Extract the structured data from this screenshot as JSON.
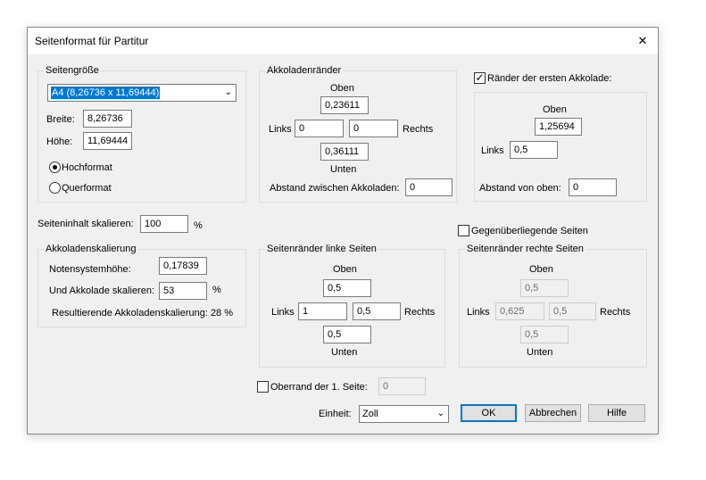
{
  "dialog": {
    "title": "Seitenformat für Partitur",
    "close_glyph": "✕"
  },
  "page_size": {
    "group_label": "Seitengröße",
    "selected": "A4 (8,26736 x 11,69444)",
    "width_label": "Breite:",
    "width_value": "8,26736",
    "height_label": "Höhe:",
    "height_value": "11,69444",
    "portrait_label": "Hochformat",
    "landscape_label": "Querformat"
  },
  "system_margins": {
    "group_label": "Akkoladenränder",
    "top_label": "Oben",
    "top_value": "0,23611",
    "left_label": "Links",
    "left_value": "0",
    "right_value": "0",
    "right_label": "Rechts",
    "bottom_value": "0,36111",
    "bottom_label": "Unten",
    "spacing_label": "Abstand zwischen Akkoladen:",
    "spacing_value": "0"
  },
  "first_system": {
    "checkbox_label": "Ränder der ersten Akkolade:",
    "checked": true,
    "top_label": "Oben",
    "top_value": "1,25694",
    "left_label": "Links",
    "left_value": "0,5",
    "distance_label": "Abstand von oben:",
    "distance_value": "0"
  },
  "scale": {
    "label": "Seiteninhalt skalieren:",
    "value": "100",
    "unit": "%"
  },
  "facing_pages": {
    "label": "Gegenüberliegende Seiten",
    "checked": false
  },
  "system_scaling": {
    "group_label": "Akkoladenskalierung",
    "staff_height_label": "Notensystemhöhe:",
    "staff_height_value": "0,17839",
    "scale_label": "Und Akkolade skalieren:",
    "scale_value": "53",
    "scale_unit": "%",
    "result_text": "Resultierende Akkoladenskalierung: 28 %"
  },
  "left_pages": {
    "group_label": "Seitenränder linke Seiten",
    "top_label": "Oben",
    "top_value": "0,5",
    "left_label": "Links",
    "left_value": "1",
    "right_value": "0,5",
    "right_label": "Rechts",
    "bottom_value": "0,5",
    "bottom_label": "Unten"
  },
  "right_pages": {
    "group_label": "Seitenränder rechte Seiten",
    "top_label": "Oben",
    "top_value": "0,5",
    "left_label": "Links",
    "left_value": "0,625",
    "right_value": "0,5",
    "right_label": "Rechts",
    "bottom_value": "0,5",
    "bottom_label": "Unten"
  },
  "first_page_top": {
    "label": "Oberrand der 1. Seite:",
    "value": "0",
    "checked": false
  },
  "units": {
    "label": "Einheit:",
    "value": "Zoll"
  },
  "buttons": {
    "ok": "OK",
    "cancel": "Abbrechen",
    "help": "Hilfe"
  },
  "icons": {
    "close": "close-icon",
    "dropdown": "chevron-down-icon",
    "check": "checkmark-icon"
  },
  "colors": {
    "selection": "#0078d7",
    "dialog_bg": "#f0f0f0",
    "default_button_border": "#0078d7"
  }
}
